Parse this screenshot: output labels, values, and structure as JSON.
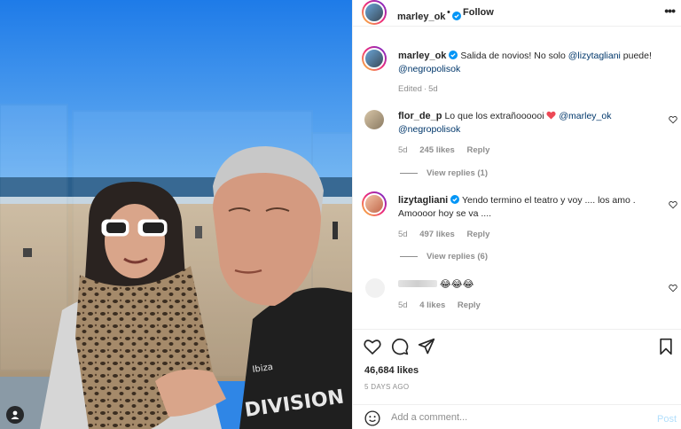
{
  "header": {
    "username": "marley_ok",
    "separator": "•",
    "follow_label": "Follow",
    "more_label": "•••"
  },
  "caption": {
    "username": "marley_ok",
    "text_before": "Salida de novios! No solo ",
    "mention1": "@lizytagliani",
    "text_after": " puede!",
    "mention2": "@negropolisok",
    "edited": "Edited",
    "time": "5d"
  },
  "comments": [
    {
      "username": "flor_de_p",
      "text": "Lo que los extrañoooooi",
      "mention1": "@marley_ok",
      "mention2": "@negropolisok",
      "time": "5d",
      "likes": "245 likes",
      "reply": "Reply",
      "view_replies": "View replies (1)"
    },
    {
      "username": "lizytagliani",
      "text": "Yendo termino el teatro y voy .... los amo .",
      "text2": "Amoooor hoy se va ....",
      "time": "5d",
      "likes": "497 likes",
      "reply": "Reply",
      "view_replies": "View replies (6)"
    },
    {
      "username": "",
      "text": "😂😂😂",
      "time": "5d",
      "likes": "4 likes",
      "reply": "Reply"
    }
  ],
  "actions": {
    "likes": "46,684 likes",
    "date": "5 DAYS AGO"
  },
  "comment_box": {
    "placeholder": "Add a comment...",
    "post_label": "Post"
  },
  "colors": {
    "mention": "#00376b",
    "verified": "#0095f6",
    "like_red": "#ed4956"
  }
}
